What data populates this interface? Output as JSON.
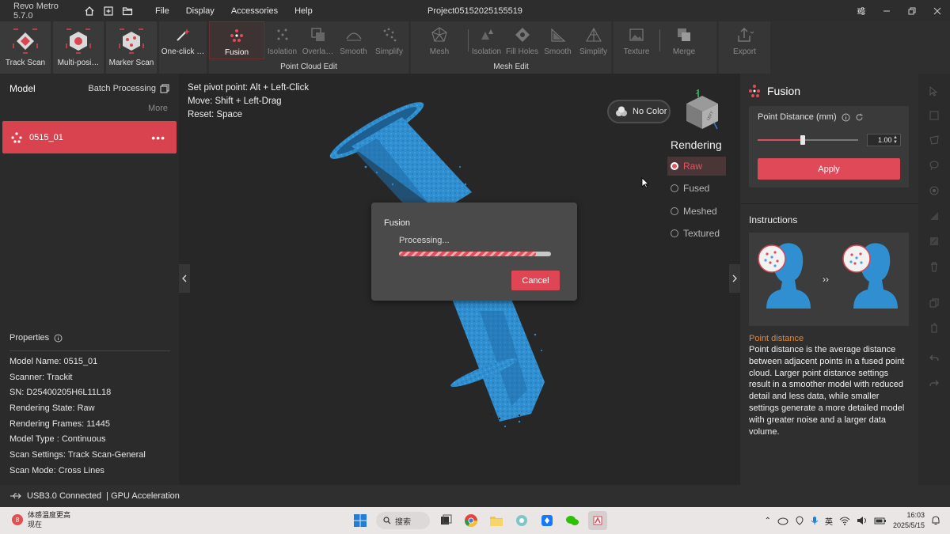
{
  "titlebar": {
    "app_title": "Revo Metro 5.7.0",
    "menu": [
      "File",
      "Display",
      "Accessories",
      "Help"
    ],
    "project": "Project05152025155519"
  },
  "toolbar": {
    "scan": [
      "Track Scan",
      "Multi-posi…",
      "Marker Scan"
    ],
    "oneclick": "One-click …",
    "point_cloud": {
      "title": "Point Cloud Edit",
      "tools": [
        "Fusion",
        "Isolation",
        "Overla…",
        "Smooth",
        "Simplify"
      ]
    },
    "mesh": {
      "title": "Mesh Edit",
      "tools": [
        "Mesh",
        "Isolation",
        "Fill Holes",
        "Smooth",
        "Simplify"
      ]
    },
    "texture": "Texture",
    "merge": "Merge",
    "export": "Export"
  },
  "left": {
    "title": "Model",
    "batch": "Batch Processing",
    "more": "More",
    "model_name": "0515_01",
    "properties_title": "Properties",
    "properties": [
      "Model Name:  0515_01",
      "Scanner:  Trackit",
      "SN:  D25400205H6L11L18",
      "Rendering State:  Raw",
      "Rendering Frames:  11445",
      "Model Type :  Continuous",
      "Scan Settings:  Track Scan-General",
      "Scan Mode:  Cross Lines"
    ]
  },
  "viewport": {
    "hints": [
      "Set pivot point:  Alt + Left-Click",
      "Move:  Shift + Left-Drag",
      "Reset:  Space"
    ],
    "no_color": "No Color",
    "rendering_title": "Rendering",
    "rendering": [
      "Raw",
      "Fused",
      "Meshed",
      "Textured"
    ],
    "cube_axis": "Z",
    "cube_face_left": "LEFT"
  },
  "dialog": {
    "title": "Fusion",
    "status": "Processing...",
    "progress": 0.9,
    "cancel": "Cancel"
  },
  "right": {
    "title": "Fusion",
    "point_distance_label": "Point Distance (mm)",
    "point_distance_value": "1.00",
    "slider_fraction": 0.45,
    "apply": "Apply",
    "instructions_title": "Instructions",
    "pd_title": "Point distance",
    "pd_text": "Point distance is the average distance between adjacent points in a fused point cloud. Larger point distance settings result in a smoother model with reduced detail and less data, while smaller settings generate a more detailed model with greater noise and a larger data volume."
  },
  "status": {
    "usb": "USB3.0 Connected",
    "gpu": "| GPU Acceleration"
  },
  "taskbar": {
    "weather_badge": "8",
    "weather_line1": "体感温度更高",
    "weather_line2": "现在",
    "search": "搜索",
    "ime": "英",
    "time": "16:03",
    "date": "2025/5/15"
  },
  "colors": {
    "accent": "#d8434f",
    "point_cloud": "#2f8fd0",
    "highlight_orange": "#e08a3c"
  }
}
